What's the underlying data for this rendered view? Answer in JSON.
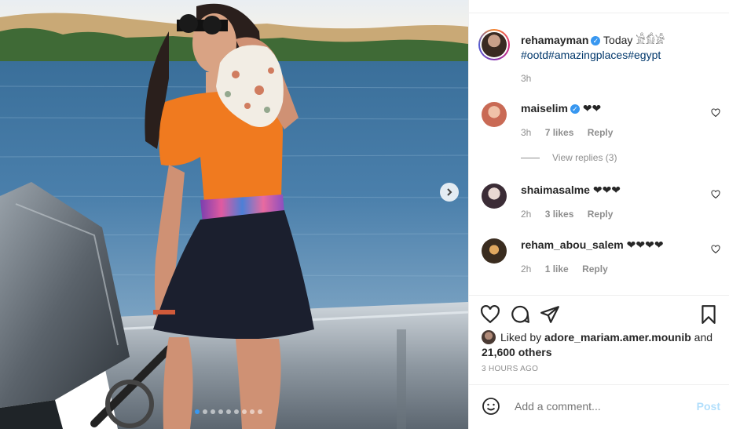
{
  "post": {
    "image": {
      "description_icon": "photo-woman-on-boat-icon",
      "carousel_dots": 9,
      "active_dot": 0
    },
    "author": {
      "username": "rehamayman",
      "verified": true
    },
    "caption": {
      "text": "Today 𓀀𓀁𓀂",
      "hashtags": "#ootd#amazingplaces#egypt"
    },
    "caption_time": "3h",
    "comments": [
      {
        "username": "maiselim",
        "verified": true,
        "text": "❤❤",
        "time": "3h",
        "likes": "7 likes",
        "reply": "Reply",
        "avatar_color": "#d98a76"
      },
      {
        "username": "shaimasalme",
        "verified": false,
        "text": "❤❤❤",
        "time": "2h",
        "likes": "3 likes",
        "reply": "Reply",
        "avatar_color": "#4a3b48"
      },
      {
        "username": "reham_abou_salem",
        "verified": false,
        "text": "❤❤❤❤",
        "time": "2h",
        "likes": "1 like",
        "reply": "Reply",
        "avatar_color": "#6b4a2b"
      }
    ],
    "view_replies": "View replies (3)",
    "liked_by": {
      "prefix": "Liked by ",
      "user": "adore_mariam.amer.mounib",
      "and": " and",
      "others": "21,600 others"
    },
    "time_ago": "3 HOURS AGO",
    "add_comment": {
      "placeholder": "Add a comment...",
      "post_label": "Post"
    }
  }
}
